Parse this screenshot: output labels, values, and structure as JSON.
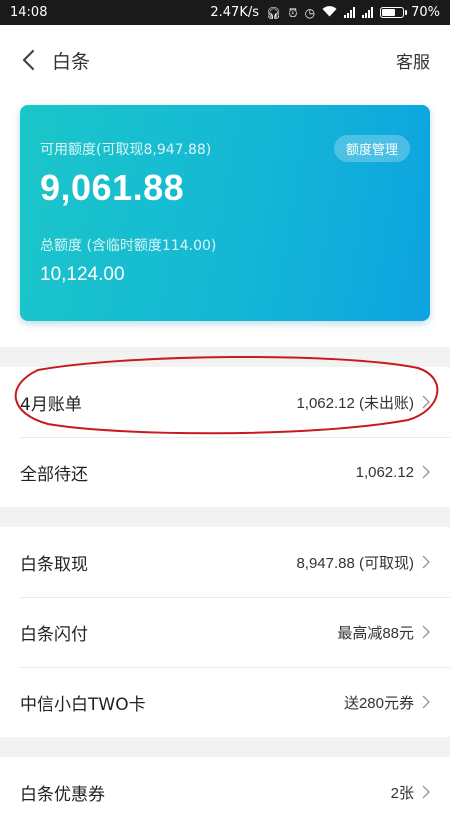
{
  "status_bar": {
    "time": "14:08",
    "speed": "2.47K/s",
    "battery": "70%",
    "battery_level": 0.7
  },
  "nav": {
    "title": "白条",
    "right_label": "客服"
  },
  "card": {
    "available_label": "可用额度(可取现8,947.88)",
    "available_amount": "9,061.88",
    "manage_button": "额度管理",
    "total_label": "总额度 (含临时额度114.00)",
    "total_amount": "10,124.00"
  },
  "sections": [
    {
      "rows": [
        {
          "name": "row-april-bill",
          "label": "4月账单",
          "value": "1,062.12 (未出账)"
        },
        {
          "name": "row-all-due",
          "label": "全部待还",
          "value": "1,062.12"
        }
      ]
    },
    {
      "rows": [
        {
          "name": "row-cash-withdraw",
          "label": "白条取现",
          "value": "8,947.88 (可取现)"
        },
        {
          "name": "row-flash-pay",
          "label": "白条闪付",
          "value": "最高减88元"
        },
        {
          "name": "row-citic-card",
          "label": "中信小白TWO卡",
          "value": "送280元券"
        }
      ]
    },
    {
      "rows": [
        {
          "name": "row-coupons",
          "label": "白条优惠券",
          "value": "2张"
        }
      ]
    }
  ],
  "colors": {
    "card_gradient_start": "#1bc6c9",
    "card_gradient_end": "#0da3e1",
    "annotation_red": "#c8191e"
  }
}
